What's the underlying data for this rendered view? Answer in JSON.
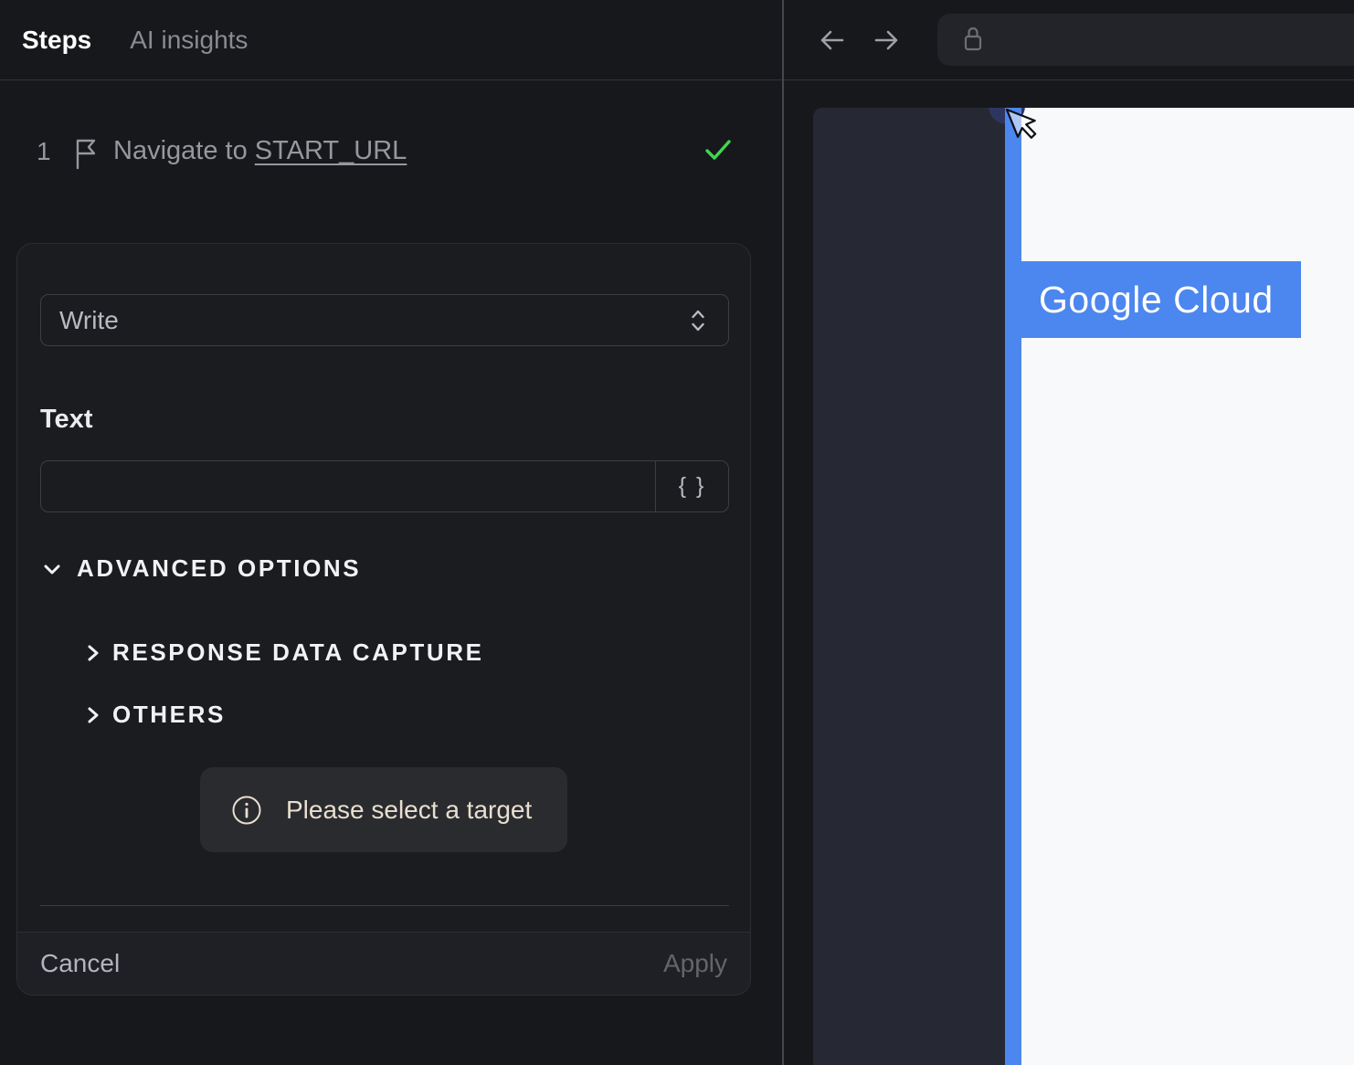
{
  "tabs": {
    "steps": "Steps",
    "ai_insights": "AI insights"
  },
  "step": {
    "number": "1",
    "text": "Navigate to",
    "link": "START_URL"
  },
  "form": {
    "action_select_value": "Write",
    "text_label": "Text",
    "text_value": "",
    "braces_label": "{ }",
    "advanced_options": "ADVANCED OPTIONS",
    "response_data_capture": "RESPONSE DATA CAPTURE",
    "others": "OTHERS",
    "info_message": "Please select a target",
    "cancel_label": "Cancel",
    "apply_label": "Apply"
  },
  "browser": {
    "page_brand": "Google Cloud"
  },
  "colors": {
    "accent_blue": "#4c86ef",
    "check_green": "#3fd64f",
    "info_cream": "#e8dfcf",
    "selection_navy": "#2e3560"
  }
}
